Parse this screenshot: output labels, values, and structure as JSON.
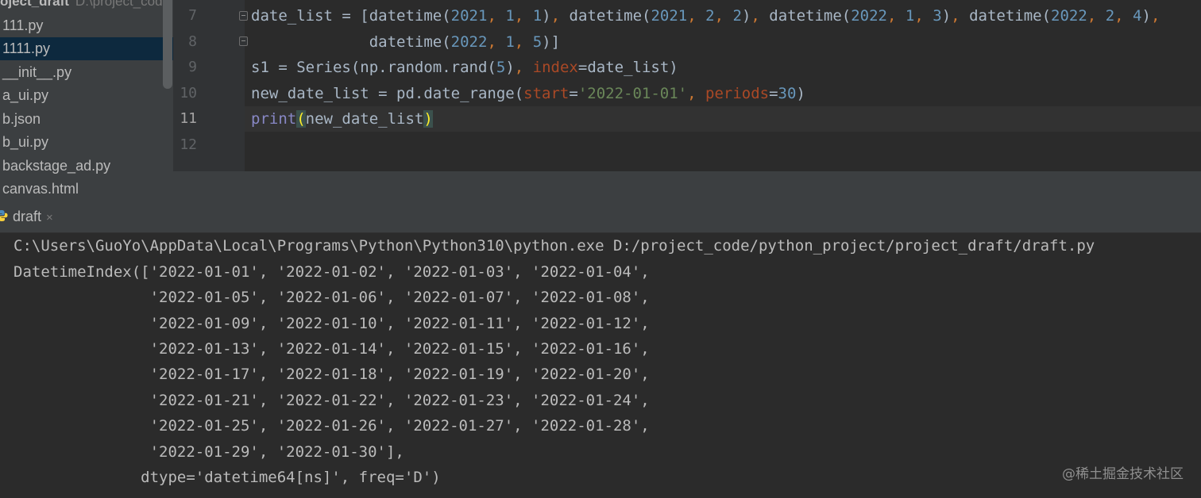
{
  "sidebar": {
    "project_name": "oject_draft",
    "project_path": "D:\\project_cod",
    "files": [
      {
        "name": "111.py"
      },
      {
        "name": "1111.py",
        "selected": true
      },
      {
        "name": "__init__.py"
      },
      {
        "name": "a_ui.py"
      },
      {
        "name": "b.json"
      },
      {
        "name": "b_ui.py"
      },
      {
        "name": "backstage_ad.py"
      },
      {
        "name": "canvas.html"
      }
    ]
  },
  "editor": {
    "line_numbers": [
      "7",
      "8",
      "9",
      "10",
      "11",
      "12"
    ],
    "current_line": "11",
    "lines": [
      "date_list = [datetime(2021, 1, 1), datetime(2021, 2, 2), datetime(2022, 1, 3), datetime(2022, 2, 4),",
      "             datetime(2022, 1, 5)]",
      "s1 = Series(np.random.rand(5), index=date_list)",
      "new_date_list = pd.date_range(start='2022-01-01', periods=30)",
      "print(new_date_list)",
      ""
    ]
  },
  "run_panel": {
    "tab_label": "draft",
    "close_glyph": "×",
    "output": [
      "C:\\Users\\GuoYo\\AppData\\Local\\Programs\\Python\\Python310\\python.exe D:/project_code/python_project/project_draft/draft.py",
      "DatetimeIndex(['2022-01-01', '2022-01-02', '2022-01-03', '2022-01-04',",
      "               '2022-01-05', '2022-01-06', '2022-01-07', '2022-01-08',",
      "               '2022-01-09', '2022-01-10', '2022-01-11', '2022-01-12',",
      "               '2022-01-13', '2022-01-14', '2022-01-15', '2022-01-16',",
      "               '2022-01-17', '2022-01-18', '2022-01-19', '2022-01-20',",
      "               '2022-01-21', '2022-01-22', '2022-01-23', '2022-01-24',",
      "               '2022-01-25', '2022-01-26', '2022-01-27', '2022-01-28',",
      "               '2022-01-29', '2022-01-30'],",
      "              dtype='datetime64[ns]', freq='D')"
    ]
  },
  "watermark": "@稀土掘金技术社区",
  "colors": {
    "background": "#2b2b2b",
    "sidebar_bg": "#3c3f41",
    "selection": "#0d293e",
    "number": "#6897bb",
    "keyword": "#cc7832",
    "string": "#6a8759",
    "param": "#aa4926",
    "builtin": "#8888c6",
    "bracket_match": "#ffef28"
  },
  "icons": {
    "run_tab": "python-icon",
    "close": "close-icon",
    "fold": "fold-marker-icon"
  }
}
